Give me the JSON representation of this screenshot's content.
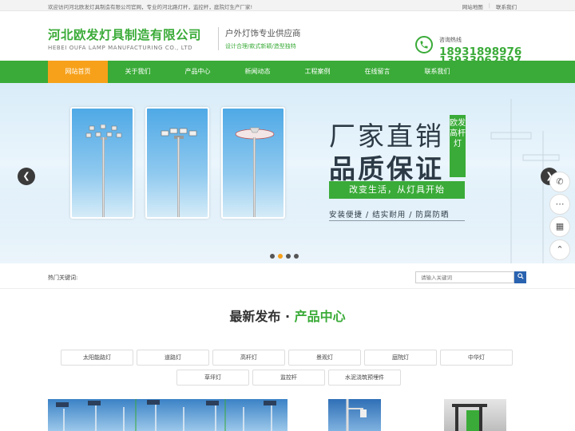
{
  "topbar": {
    "welcome": "欢迎访问河北欧发灯具制造有限公司官网，专业的河北路灯杆，监控杆，庭院灯生产厂家!",
    "links": [
      "网站地图",
      "联系我们"
    ]
  },
  "header": {
    "company_cn": "河北欧发灯具制造有限公司",
    "company_en": "HEBEI OUFA LAMP MANUFACTURING CO., LTD",
    "slogan": "户外灯饰专业供应商",
    "slogan_sub": "设计合理/款式新颖/造型独特",
    "hotline_label": "咨询热线",
    "phone1": "18931898976",
    "phone2": "13933062597"
  },
  "nav": {
    "items": [
      "网站首页",
      "关于我们",
      "产品中心",
      "新闻动态",
      "工程案例",
      "在线留言",
      "联系我们"
    ],
    "active_index": 0
  },
  "banner": {
    "title1": "厂家直销",
    "title2": "品质保证",
    "vertical_tag": "欧发高杆灯",
    "green_bar": "改变生活，从灯具开始",
    "features": "安装便捷 / 结实耐用 / 防腐防晒",
    "slide_count": 4,
    "active_slide": 1
  },
  "search": {
    "hot_label": "热门关键词:",
    "placeholder": "请输入关键词"
  },
  "section": {
    "title_a": "最新发布 · ",
    "title_b": "产品中心"
  },
  "categories_row1": [
    "太阳能路灯",
    "道路灯",
    "高杆灯",
    "景观灯",
    "庭院灯",
    "中华灯"
  ],
  "categories_row2": [
    "草坪灯",
    "监控杆",
    "水泥浇筑预埋件"
  ],
  "colors": {
    "brand_green": "#3aab38",
    "accent_orange": "#f7a11a"
  },
  "icons": [
    "phone-icon",
    "chevron-left-icon",
    "chevron-right-icon",
    "phone-float-icon",
    "chat-float-icon",
    "qrcode-float-icon",
    "arrow-up-float-icon",
    "search-icon"
  ]
}
